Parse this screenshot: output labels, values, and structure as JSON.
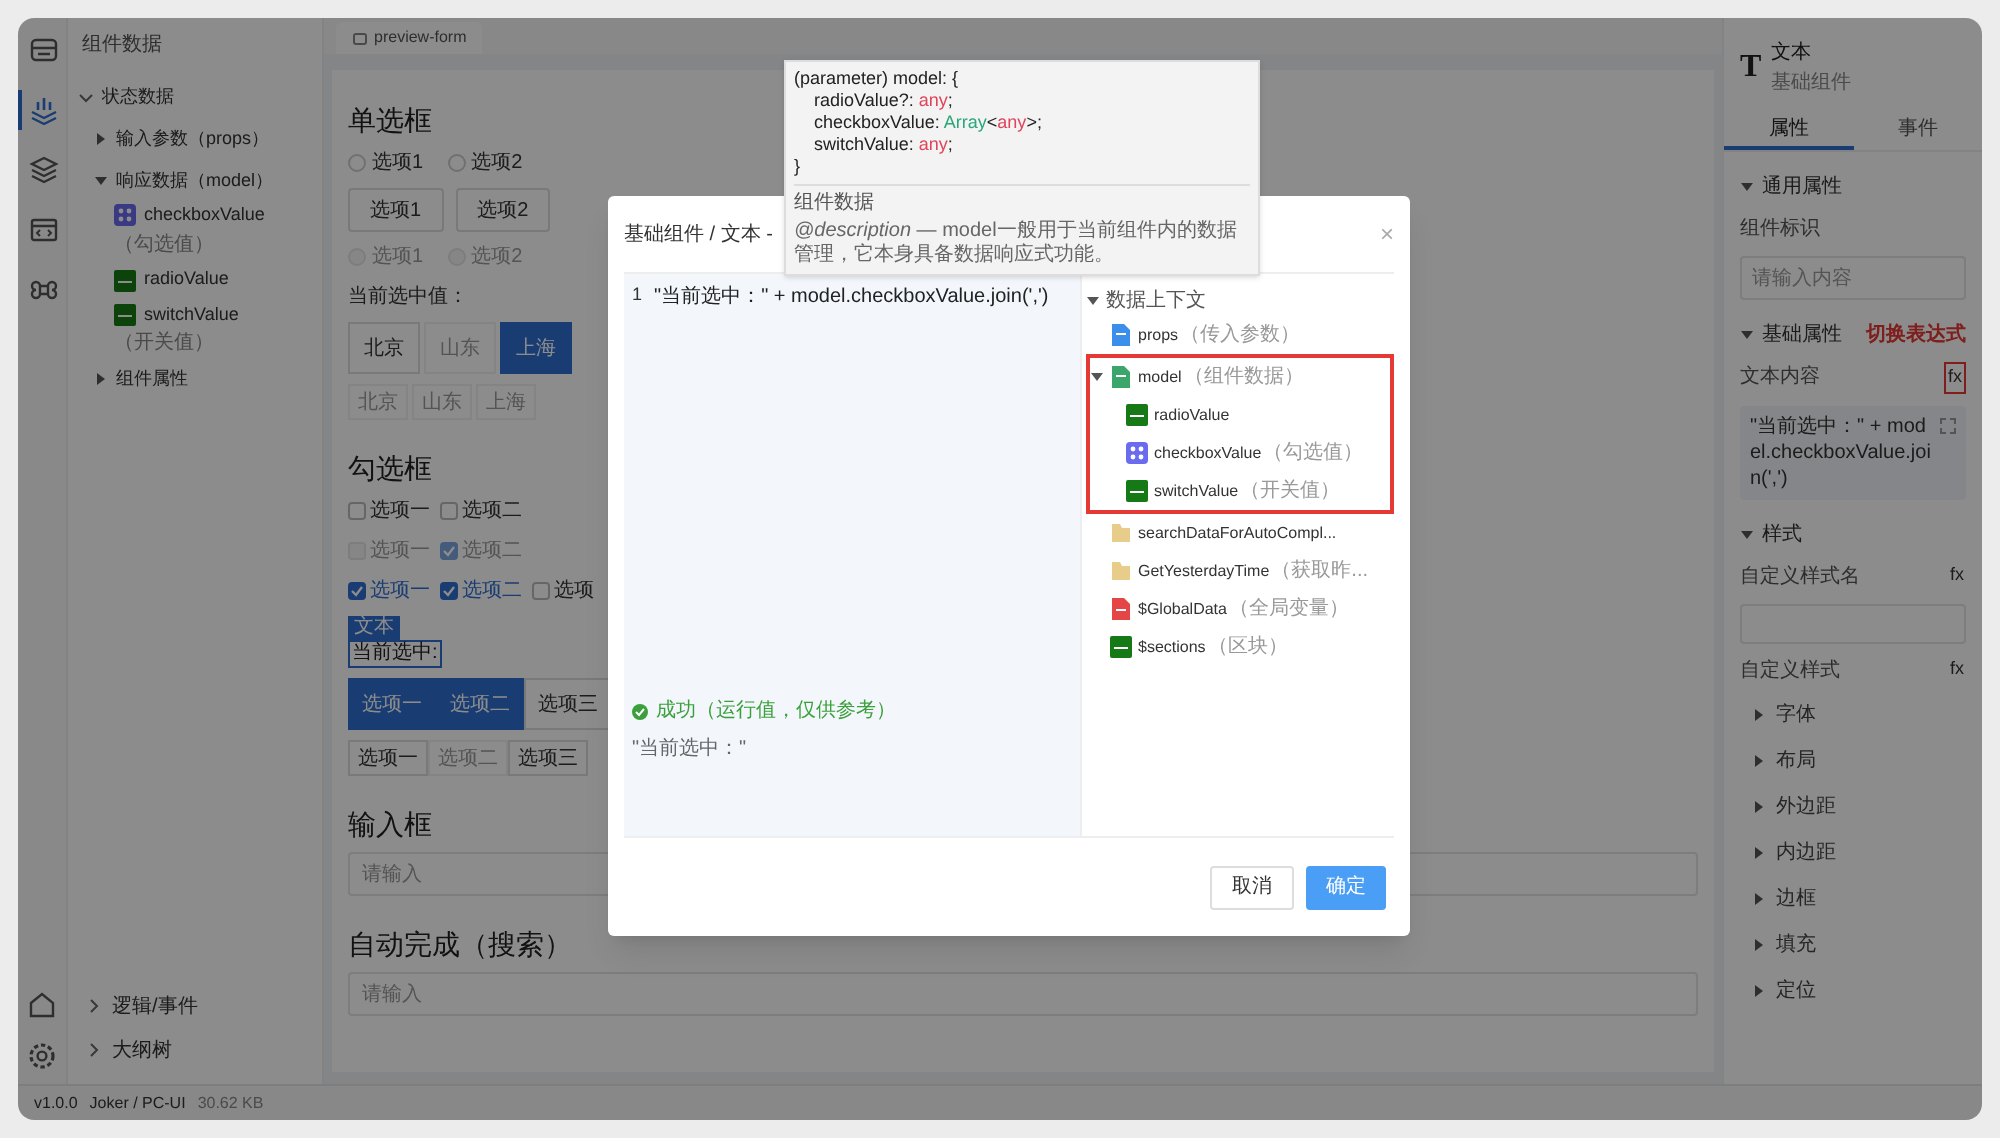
{
  "rail": {
    "top": [
      {
        "kind": "template",
        "selected": false
      },
      {
        "kind": "data",
        "selected": true
      },
      {
        "kind": "layers",
        "selected": false
      },
      {
        "kind": "code",
        "selected": false
      },
      {
        "kind": "command",
        "selected": false
      }
    ],
    "bottom": [
      {
        "kind": "home"
      },
      {
        "kind": "settings"
      }
    ]
  },
  "data_panel": {
    "title": "组件数据",
    "tree": [
      {
        "label": "状态数据",
        "expanded": true,
        "children": [
          {
            "label": "输入参数（props）",
            "expanded": false
          },
          {
            "label": "响应数据（model）",
            "expanded": true,
            "children": [
              {
                "label": "checkboxValue",
                "note": "（勾选值）",
                "kind": "array"
              },
              {
                "label": "radioValue",
                "kind": "any"
              },
              {
                "label": "switchValue",
                "note": "（开关值）",
                "kind": "any"
              }
            ]
          },
          {
            "label": "组件属性",
            "expanded": false
          }
        ]
      }
    ],
    "bottom": [
      {
        "label": "逻辑/事件",
        "expanded": false
      },
      {
        "label": "大纲树",
        "expanded": false
      }
    ]
  },
  "canvas": {
    "tab": "preview-form",
    "rows": [
      {
        "kind": "heading",
        "text": "单选框"
      },
      {
        "kind": "radios",
        "items": [
          {
            "label": "选项1",
            "checked": false,
            "disabled": false
          },
          {
            "label": "选项2",
            "checked": false,
            "disabled": false
          }
        ]
      },
      {
        "kind": "radio_buttons",
        "items": [
          {
            "label": "选项1",
            "selected": false
          },
          {
            "label": "选项2",
            "selected": false
          }
        ]
      },
      {
        "kind": "radios",
        "items": [
          {
            "label": "选项1",
            "checked": false,
            "disabled": true
          },
          {
            "label": "选项2",
            "checked": false,
            "disabled": true
          }
        ]
      },
      {
        "kind": "text",
        "text": "当前选中值："
      },
      {
        "kind": "segmented",
        "compact": false,
        "items": [
          {
            "label": "北京",
            "selected": false,
            "disabled": false
          },
          {
            "label": "山东",
            "selected": false,
            "disabled": true
          },
          {
            "label": "上海",
            "selected": true,
            "disabled": false
          }
        ]
      },
      {
        "kind": "segmented",
        "compact": true,
        "items": [
          {
            "label": "北京",
            "selected": false,
            "disabled": true
          },
          {
            "label": "山东",
            "selected": false,
            "disabled": true
          },
          {
            "label": "上海",
            "selected": false,
            "disabled": true
          }
        ]
      },
      {
        "kind": "heading",
        "text": "勾选框"
      },
      {
        "kind": "checkboxes",
        "items": [
          {
            "label": "选项一",
            "checked": false,
            "disabled": false
          },
          {
            "label": "选项二",
            "checked": false,
            "disabled": false
          }
        ]
      },
      {
        "kind": "checkboxes",
        "items": [
          {
            "label": "选项一",
            "checked": false,
            "disabled": true
          },
          {
            "label": "选项二",
            "checked": true,
            "disabled": true
          }
        ]
      },
      {
        "kind": "checkboxes",
        "items": [
          {
            "label": "选项一",
            "checked": true,
            "disabled": false
          },
          {
            "label": "选项二",
            "checked": true,
            "disabled": false
          },
          {
            "label": "选项",
            "checked": false,
            "disabled": false
          }
        ]
      },
      {
        "kind": "selected_text",
        "tag": "文本",
        "text": "当前选中:"
      },
      {
        "kind": "button_group",
        "compact": false,
        "items": [
          {
            "label": "选项一",
            "selected": true,
            "disabled": false
          },
          {
            "label": "选项二",
            "selected": true,
            "disabled": false
          },
          {
            "label": "选项三",
            "selected": false,
            "disabled": false
          }
        ]
      },
      {
        "kind": "button_group",
        "compact": true,
        "items": [
          {
            "label": "选项一",
            "selected": false,
            "disabled": false
          },
          {
            "label": "选项二",
            "selected": false,
            "disabled": true
          },
          {
            "label": "选项三",
            "selected": false,
            "disabled": false
          }
        ]
      },
      {
        "kind": "heading",
        "text": "输入框"
      },
      {
        "kind": "input",
        "placeholder": "请输入"
      },
      {
        "kind": "heading",
        "text": "自动完成（搜索）"
      },
      {
        "kind": "input",
        "placeholder": "请输入"
      }
    ]
  },
  "right_panel": {
    "icon": "T",
    "title": "文本",
    "subtitle": "基础组件",
    "tabs": [
      {
        "label": "属性",
        "selected": true
      },
      {
        "label": "事件",
        "selected": false
      }
    ],
    "sections": [
      {
        "title": "通用属性",
        "fields": [
          {
            "kind": "textarea",
            "label": "组件标识",
            "placeholder": "请输入内容"
          }
        ]
      },
      {
        "title": "基础属性",
        "annotation": "切换表达式",
        "fields": [
          {
            "kind": "expression",
            "label": "文本内容",
            "fx": "fx",
            "value": "\"当前选中：\" + model.checkboxValue.join(',')"
          }
        ]
      },
      {
        "title": "样式",
        "fields": [
          {
            "kind": "input",
            "label": "自定义样式名",
            "fx": "fx"
          },
          {
            "kind": "group",
            "label": "自定义样式",
            "fx": "fx",
            "items": [
              "字体",
              "布局",
              "外边距",
              "内边距",
              "边框",
              "填充",
              "定位"
            ]
          }
        ]
      }
    ]
  },
  "status_bar": {
    "version": "v1.0.0",
    "author": "Joker / PC-UI",
    "size": "30.62 KB"
  },
  "modal": {
    "title": "基础组件 / 文本 -",
    "close": "×",
    "editor": {
      "line_number": "1",
      "code": "\"当前选中：\" + model.checkboxValue.join(',')"
    },
    "result": {
      "status": "成功（运行值，仅供参考）",
      "value": "\"当前选中：\""
    },
    "context": {
      "title": "数据上下文",
      "items": [
        {
          "label": "props",
          "note": "（传入参数）",
          "kind": "object"
        },
        {
          "label": "model",
          "note": "（组件数据）",
          "kind": "data",
          "expanded": true,
          "highlighted": true,
          "children": [
            {
              "label": "radioValue",
              "kind": "any"
            },
            {
              "label": "checkboxValue",
              "note": "（勾选值）",
              "kind": "array"
            },
            {
              "label": "switchValue",
              "note": "（开关值）",
              "kind": "any"
            }
          ]
        },
        {
          "label": "searchDataForAutoCompl...",
          "kind": "function"
        },
        {
          "label": "GetYesterdayTime",
          "note": "（获取昨...",
          "kind": "function"
        },
        {
          "label": "$GlobalData",
          "note": "（全局变量）",
          "kind": "global"
        },
        {
          "label": "$sections",
          "note": "（区块）",
          "kind": "any"
        }
      ]
    },
    "buttons": [
      {
        "label": "取消",
        "primary": false
      },
      {
        "label": "确定",
        "primary": true
      }
    ]
  },
  "tooltip": {
    "signature": {
      "open": "(parameter) model: {",
      "members": [
        {
          "name": "radioValue?: ",
          "type": [
            {
              "kind": "keyword",
              "text": "any"
            }
          ],
          "end": ";"
        },
        {
          "name": "checkboxValue: ",
          "type": [
            {
              "kind": "type",
              "text": "Array"
            },
            {
              "kind": "punct",
              "text": "<"
            },
            {
              "kind": "keyword",
              "text": "any"
            },
            {
              "kind": "punct",
              "text": ">"
            }
          ],
          "end": ";"
        },
        {
          "name": "switchValue: ",
          "type": [
            {
              "kind": "keyword",
              "text": "any"
            }
          ],
          "end": ";"
        }
      ],
      "close": "}"
    },
    "title": "组件数据",
    "description": "*@description* — model一般用于当前组件内的数据管理，它本身具备数据响应式功能。"
  }
}
